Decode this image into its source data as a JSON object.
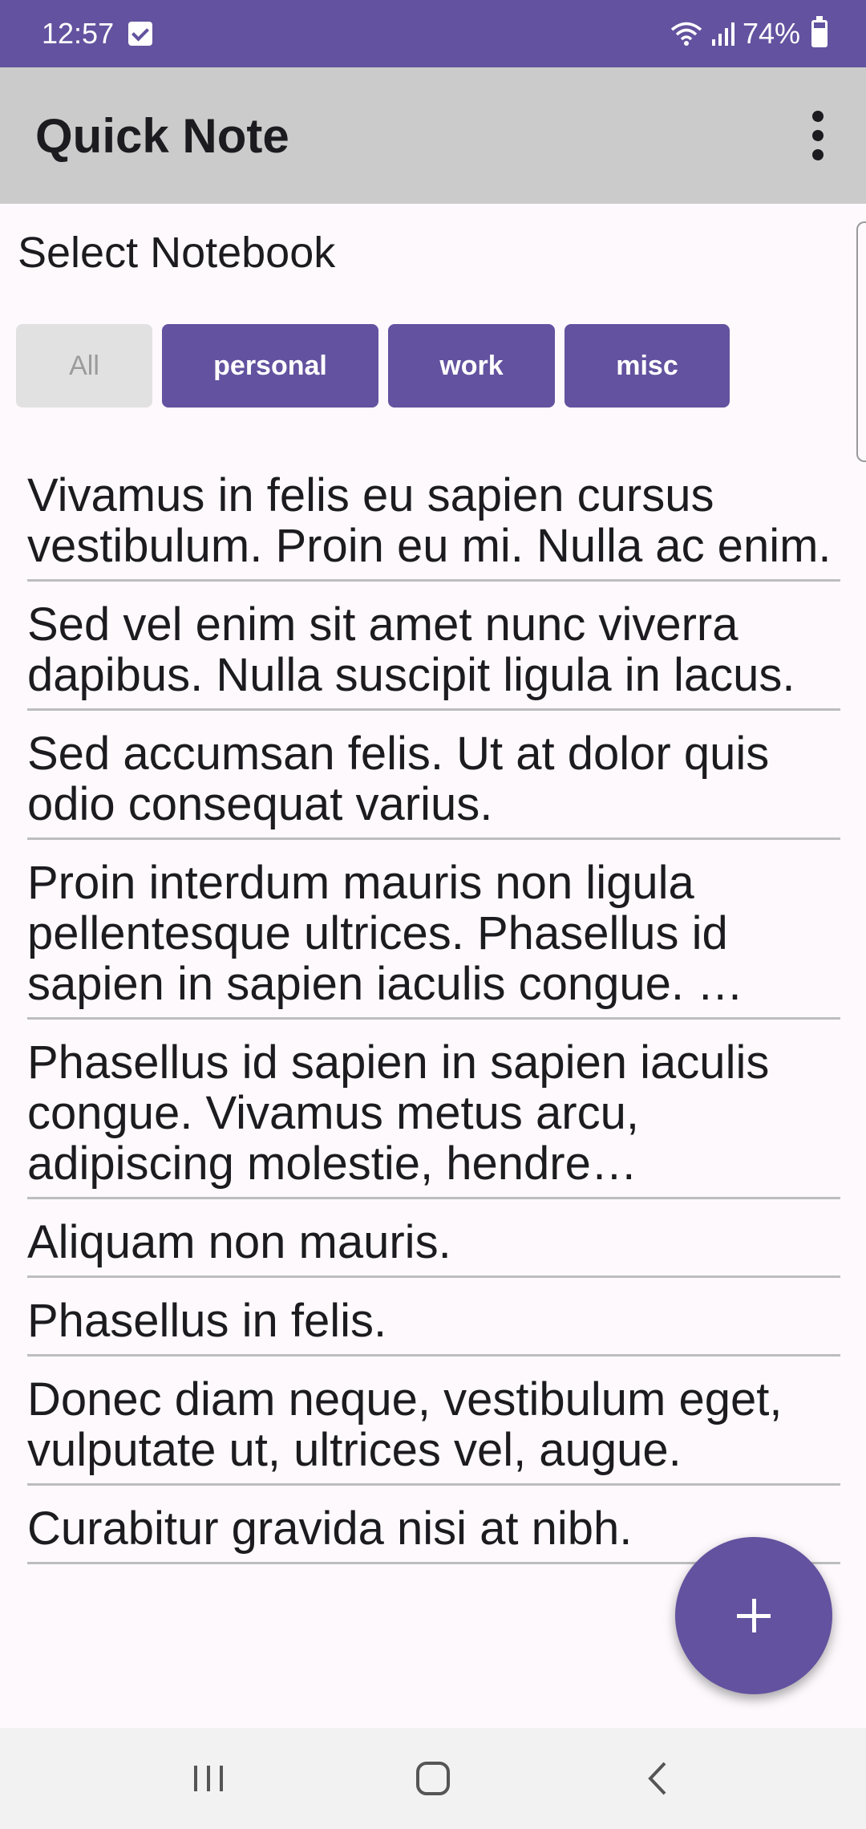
{
  "status_bar": {
    "time": "12:57",
    "battery": "74%",
    "icons": [
      "check-icon",
      "wifi-icon",
      "signal-icon",
      "battery-icon"
    ]
  },
  "app_bar": {
    "title": "Quick Note",
    "menu_icon": "more-vert-icon"
  },
  "notebook_section": {
    "label": "Select Notebook",
    "chips": [
      {
        "label": "All",
        "selected": true
      },
      {
        "label": "personal",
        "selected": false
      },
      {
        "label": "work",
        "selected": false
      },
      {
        "label": "misc",
        "selected": false
      }
    ]
  },
  "notes": [
    "Vivamus in felis eu sapien cursus vestibulum. Proin eu mi. Nulla ac enim.",
    "Sed vel enim sit amet nunc viverra dapibus. Nulla suscipit ligula in lacus.",
    "Sed accumsan felis. Ut at dolor quis odio consequat varius.",
    "Proin interdum mauris non ligula pellentesque ultrices. Phasellus id sapien in sapien iaculis congue. …",
    "Phasellus id sapien in sapien iaculis congue. Vivamus metus arcu, adipiscing molestie, hendre…",
    "Aliquam non mauris.",
    "Phasellus in felis.",
    "Donec diam neque, vestibulum eget, vulputate ut, ultrices vel, augue.",
    "Curabitur gravida nisi at nibh."
  ],
  "fab": {
    "icon": "plus-icon"
  },
  "colors": {
    "primary": "#63529f",
    "app_bar": "#cbcbcb",
    "background": "#fdf9fd",
    "chip_unselected": "#e1e1e1"
  }
}
